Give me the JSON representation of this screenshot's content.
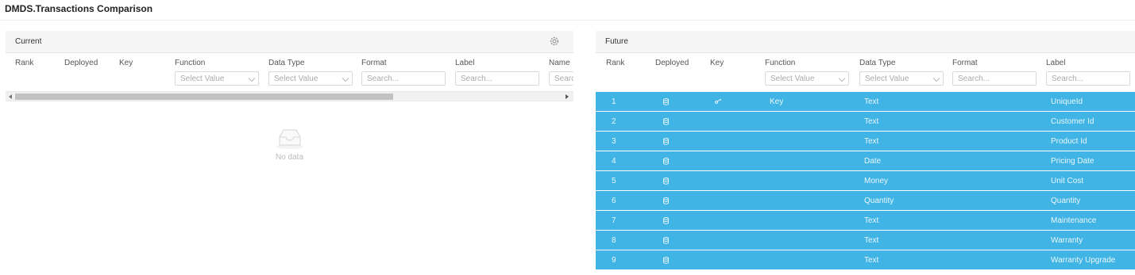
{
  "page_title": "DMDS.Transactions Comparison",
  "colors": {
    "row_selected": "#40b4e5",
    "header_bg": "#f5f5f5"
  },
  "current": {
    "title": "Current",
    "columns": [
      "Rank",
      "Deployed",
      "Key",
      "Function",
      "Data Type",
      "Format",
      "Label",
      "Name"
    ],
    "filters": {
      "function": "Select Value",
      "data_type": "Select Value",
      "format": "Search...",
      "label": "Search...",
      "name": "Searc"
    },
    "settings_icon": "gear-icon",
    "empty_text": "No data"
  },
  "future": {
    "title": "Future",
    "columns": [
      "Rank",
      "Deployed",
      "Key",
      "Function",
      "Data Type",
      "Format",
      "Label"
    ],
    "filters": {
      "function": "Select Value",
      "data_type": "Select Value",
      "format": "Search...",
      "label": "Search..."
    },
    "rows": [
      {
        "rank": "1",
        "key": "key-icon",
        "function": "Key",
        "data_type": "Text",
        "format": "",
        "label": "UniqueId"
      },
      {
        "rank": "2",
        "function": "",
        "data_type": "Text",
        "format": "",
        "label": "Customer Id"
      },
      {
        "rank": "3",
        "function": "",
        "data_type": "Text",
        "format": "",
        "label": "Product Id"
      },
      {
        "rank": "4",
        "function": "",
        "data_type": "Date",
        "format": "",
        "label": "Pricing Date"
      },
      {
        "rank": "5",
        "function": "",
        "data_type": "Money",
        "format": "",
        "label": "Unit Cost"
      },
      {
        "rank": "6",
        "function": "",
        "data_type": "Quantity",
        "format": "",
        "label": "Quantity"
      },
      {
        "rank": "7",
        "function": "",
        "data_type": "Text",
        "format": "",
        "label": "Maintenance"
      },
      {
        "rank": "8",
        "function": "",
        "data_type": "Text",
        "format": "",
        "label": "Warranty"
      },
      {
        "rank": "9",
        "function": "",
        "data_type": "Text",
        "format": "",
        "label": "Warranty Upgrade"
      }
    ]
  }
}
